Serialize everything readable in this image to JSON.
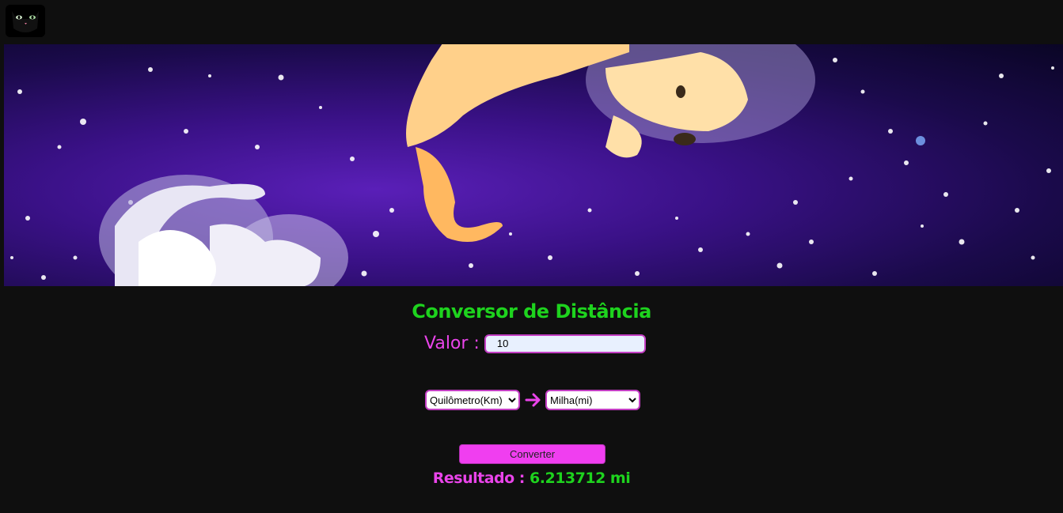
{
  "logo": {
    "icon": "black-cat-face-icon"
  },
  "banner": {
    "description_icon": "space-cats-banner-image"
  },
  "title": "Conversor de Distância",
  "valor": {
    "label": "Valor :",
    "value": "10"
  },
  "from_unit": {
    "selected": "Quilômetro(Km)",
    "options": [
      "Quilômetro(Km)"
    ]
  },
  "to_unit": {
    "selected": "Milha(mi)",
    "options": [
      "Milha(mi)"
    ]
  },
  "convert_button": "Converter",
  "result": {
    "label": "Resultado :",
    "value": "6.213712 mi"
  },
  "colors": {
    "background": "#0f0f0f",
    "accent_green": "#1ed31e",
    "accent_pink": "#ea44ea",
    "button": "#f03ef0"
  }
}
